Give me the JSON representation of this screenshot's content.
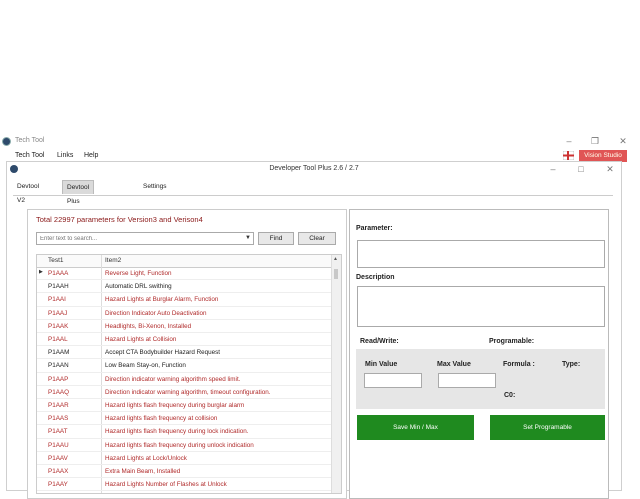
{
  "bg_window": {
    "title": "Tech Tool",
    "menu": [
      "Tech Tool",
      "Links",
      "Help"
    ],
    "user_button": "Vision Studio",
    "controls": [
      "–",
      "❐",
      "✕"
    ]
  },
  "dev_window": {
    "title": "Developer Tool Plus 2.6 / 2.7",
    "controls": [
      "–",
      "□",
      "✕"
    ],
    "tabs": [
      {
        "label": "Devtool V2",
        "active": false
      },
      {
        "label": "Devtool Plus V3/V4",
        "active": true
      },
      {
        "label": "Settings",
        "active": false
      }
    ]
  },
  "left": {
    "total": "Total 22997 parameters for Version3 and Verison4",
    "search_placeholder": "Enter text to search...",
    "find": "Find",
    "clear": "Clear",
    "columns": [
      "Test1",
      "Item2"
    ],
    "rows": [
      {
        "id": "P1AAA",
        "item": "Reverse Light, Function",
        "red": true
      },
      {
        "id": "P1AAH",
        "item": "Automatic DRL swithing",
        "red": false
      },
      {
        "id": "P1AAI",
        "item": "Hazard Lights at Burglar Alarm, Function",
        "red": true
      },
      {
        "id": "P1AAJ",
        "item": "Direction Indicator Auto Deactivation",
        "red": true
      },
      {
        "id": "P1AAK",
        "item": "Headlights, Bi-Xenon, Installed",
        "red": true
      },
      {
        "id": "P1AAL",
        "item": "Hazard Lights at Collision",
        "red": true
      },
      {
        "id": "P1AAM",
        "item": "Accept CTA Bodybuilder Hazard Request",
        "red": false
      },
      {
        "id": "P1AAN",
        "item": "Low Beam Stay-on, Function",
        "red": false
      },
      {
        "id": "P1AAP",
        "item": "Direction indicator warning algorithm speed limit.",
        "red": true
      },
      {
        "id": "P1AAQ",
        "item": "Direction indicator warning algorithm, timeout configuration.",
        "red": true
      },
      {
        "id": "P1AAR",
        "item": "Hazard lights flash frequency during burglar alarm",
        "red": true
      },
      {
        "id": "P1AAS",
        "item": "Hazard lights flash frequency at collision",
        "red": true
      },
      {
        "id": "P1AAT",
        "item": "Hazard lights flash frequency during lock indication.",
        "red": true
      },
      {
        "id": "P1AAU",
        "item": "Hazard lights flash frequency during unlock indication",
        "red": true
      },
      {
        "id": "P1AAV",
        "item": "Hazard Lights at Lock/Unlock",
        "red": true
      },
      {
        "id": "P1AAX",
        "item": "Extra Main Beam, Installed",
        "red": true
      },
      {
        "id": "P1AAY",
        "item": "Hazard Lights Number of Flashes at Unlock",
        "red": true
      }
    ]
  },
  "right": {
    "parameter": "Parameter:",
    "description": "Description",
    "read_write": "Read/Write:",
    "programable": "Programable:",
    "min_value": "Min Value",
    "max_value": "Max Value",
    "formula": "Formula :",
    "type": "Type:",
    "c0": "C0:",
    "save_btn": "Save Min / Max",
    "set_btn": "Set Programable"
  }
}
